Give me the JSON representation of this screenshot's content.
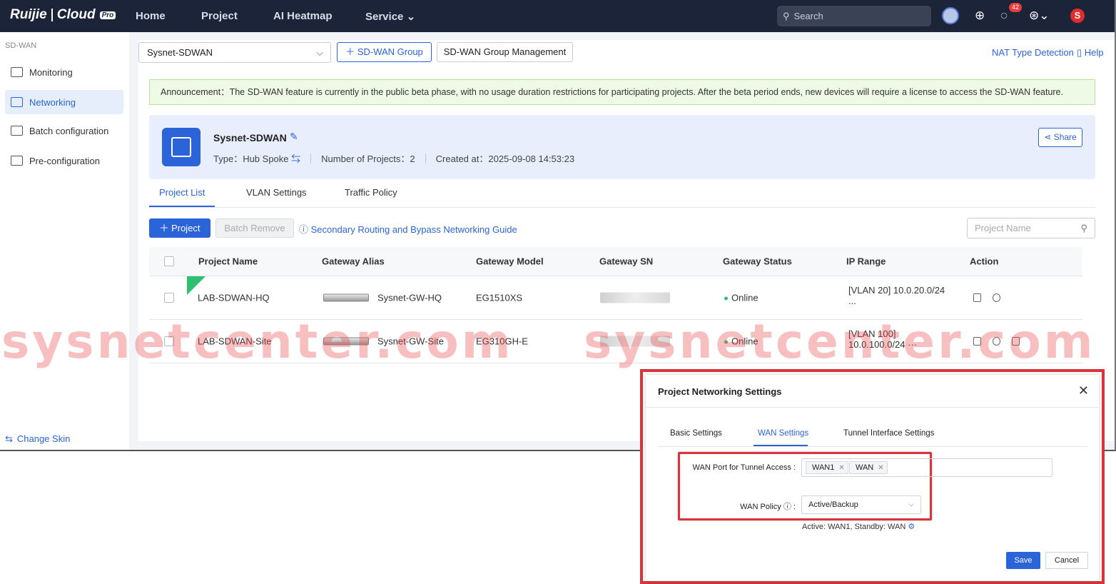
{
  "topbar": {
    "brand": "Ruijie",
    "product": "Cloud",
    "pro_badge": "Pro",
    "nav": [
      "Home",
      "Project",
      "AI Heatmap",
      "Service"
    ],
    "search_placeholder": "Search",
    "message_count": "42",
    "avatar_letter": "S"
  },
  "sidebar": {
    "section_title": "SD-WAN",
    "items": [
      {
        "label": "Monitoring",
        "active": false
      },
      {
        "label": "Networking",
        "active": true
      },
      {
        "label": "Batch configuration",
        "active": false
      },
      {
        "label": "Pre-configuration",
        "active": false
      }
    ],
    "change_skin": "Change Skin"
  },
  "toolbar": {
    "group_select": "Sysnet-SDWAN",
    "add_group_button": "SD-WAN Group",
    "manage_button": "SD-WAN Group Management",
    "nat_link": "NAT Type Detection",
    "help_link": "Help"
  },
  "announcement": "Announcement：The SD-WAN feature is currently in the public beta phase, with no usage duration restrictions for participating projects. After the beta period ends, new devices will require a license to access the SD-WAN feature.",
  "group_info": {
    "name": "Sysnet-SDWAN",
    "type_label": "Type：",
    "type_value": "Hub Spoke",
    "projects_label": "Number of Projects：",
    "projects_value": "2",
    "created_label": "Created at：",
    "created_value": "2025-09-08 14:53:23",
    "share_button": "Share"
  },
  "tabs": [
    "Project List",
    "VLAN Settings",
    "Traffic Policy"
  ],
  "actions": {
    "add_project": "Project",
    "batch_remove": "Batch Remove",
    "guide_link": "Secondary Routing and Bypass Networking Guide",
    "search_placeholder": "Project Name"
  },
  "table": {
    "headers": [
      "Project Name",
      "Gateway Alias",
      "Gateway Model",
      "Gateway SN",
      "Gateway Status",
      "IP Range",
      "Action"
    ],
    "rows": [
      {
        "hq": true,
        "project": "LAB-SDWAN-HQ",
        "alias": "Sysnet-GW-HQ",
        "model": "EG1510XS",
        "status": "Online",
        "ip_line1": "[VLAN 20] 10.0.20.0/24",
        "ip_line2": "..."
      },
      {
        "hq": false,
        "project": "LAB-SDWAN-Site",
        "alias": "Sysnet-GW-Site",
        "model": "EG310GH-E",
        "status": "Online",
        "ip_line1": "[VLAN 100]",
        "ip_line2": "10.0.100.0/24 ···"
      }
    ],
    "hq_tag": "HQ"
  },
  "watermark": [
    "sysnetcenter.com",
    "sysnetcenter.com"
  ],
  "modal": {
    "title": "Project Networking Settings",
    "tabs": [
      "Basic Settings",
      "WAN Settings",
      "Tunnel Interface Settings"
    ],
    "active_tab": "WAN Settings",
    "wan_port_label": "WAN Port for Tunnel Access :",
    "wan_ports": [
      "WAN1",
      "WAN"
    ],
    "wan_policy_label": "WAN Policy",
    "wan_policy_value": "Active/Backup",
    "hint": "Active:  WAN1,  Standby:  WAN",
    "save": "Save",
    "cancel": "Cancel"
  },
  "colors": {
    "topbar": "#1b2438",
    "accent": "#2a64d8",
    "highlight_red": "#d9343b",
    "online": "#2fbf71"
  }
}
